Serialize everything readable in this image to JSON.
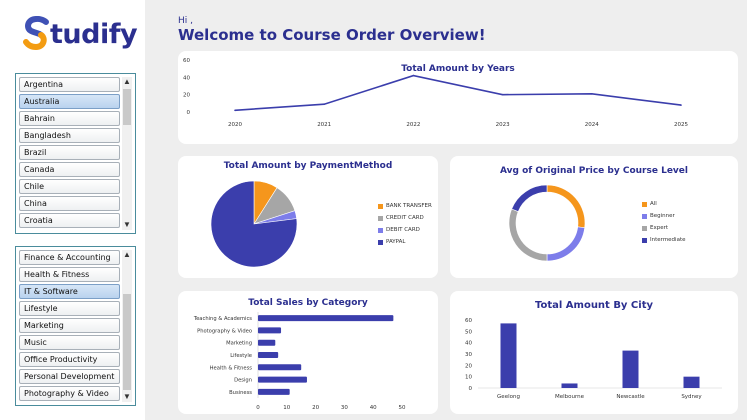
{
  "brand": {
    "name": "tudify",
    "initial": "S",
    "colors": {
      "s_top": "#3f51b5",
      "s_bottom": "#f39c12",
      "text": "#2b2f8f"
    }
  },
  "greeting": {
    "hi": "Hi ,",
    "title": "Welcome to Course Order Overview!"
  },
  "country_slicer": {
    "items": [
      {
        "label": "Argentina",
        "selected": false
      },
      {
        "label": "Australia",
        "selected": true
      },
      {
        "label": "Bahrain",
        "selected": false
      },
      {
        "label": "Bangladesh",
        "selected": false
      },
      {
        "label": "Brazil",
        "selected": false
      },
      {
        "label": "Canada",
        "selected": false
      },
      {
        "label": "Chile",
        "selected": false
      },
      {
        "label": "China",
        "selected": false
      },
      {
        "label": "Croatia",
        "selected": false
      }
    ]
  },
  "category_slicer": {
    "items": [
      {
        "label": "Finance & Accounting",
        "selected": false
      },
      {
        "label": "Health & Fitness",
        "selected": false
      },
      {
        "label": "IT & Software",
        "selected": true
      },
      {
        "label": "Lifestyle",
        "selected": false
      },
      {
        "label": "Marketing",
        "selected": false
      },
      {
        "label": "Music",
        "selected": false
      },
      {
        "label": "Office Productivity",
        "selected": false
      },
      {
        "label": "Personal Development",
        "selected": false
      },
      {
        "label": "Photography & Video",
        "selected": false
      }
    ]
  },
  "chart_data": [
    {
      "type": "line",
      "title": "Total Amount by Years",
      "x": [
        "2020",
        "2021",
        "2022",
        "2023",
        "2024",
        "2025"
      ],
      "values": [
        2,
        9,
        42,
        20,
        21,
        8
      ],
      "ylim": [
        0,
        60
      ],
      "yticks": [
        "0",
        "20",
        "40",
        "60"
      ],
      "color": "#3b3eac"
    },
    {
      "type": "pie",
      "title": "Total Amount by PaymentMethod",
      "categories": [
        "BANK TRANSFER",
        "CREDIT CARD",
        "DEBIT CARD",
        "PAYPAL"
      ],
      "values": [
        9,
        11,
        3,
        77
      ],
      "colors": [
        "#f5961c",
        "#a6a6a6",
        "#7d7dea",
        "#3b3eac"
      ],
      "legend": "right"
    },
    {
      "type": "pie",
      "title": "Avg of Original Price by Course Level",
      "categories": [
        "All",
        "Beginner",
        "Expert",
        "Intermediate"
      ],
      "values": [
        27,
        23,
        31,
        19
      ],
      "colors": [
        "#f5961c",
        "#7d7dea",
        "#a6a6a6",
        "#3b3eac"
      ],
      "legend": "right",
      "donut": true
    },
    {
      "type": "bar",
      "orientation": "horizontal",
      "title": "Total Sales by Category",
      "categories": [
        "Teaching & Academics",
        "Photography & Video",
        "Marketing",
        "Lifestyle",
        "Health & Fitness",
        "Design",
        "Business"
      ],
      "values": [
        47,
        8,
        6,
        7,
        15,
        17,
        11
      ],
      "xlim": [
        0,
        50
      ],
      "xticks": [
        "0",
        "10",
        "20",
        "30",
        "40",
        "50"
      ],
      "color": "#3b3eac"
    },
    {
      "type": "bar",
      "title": "Total Amount By City",
      "categories": [
        "Geelong",
        "Melbourne",
        "Newcastle",
        "Sydney"
      ],
      "values": [
        57,
        4,
        33,
        10
      ],
      "ylim": [
        0,
        60
      ],
      "yticks": [
        "0",
        "10",
        "20",
        "30",
        "40",
        "50",
        "60"
      ],
      "color": "#3b3eac"
    }
  ]
}
